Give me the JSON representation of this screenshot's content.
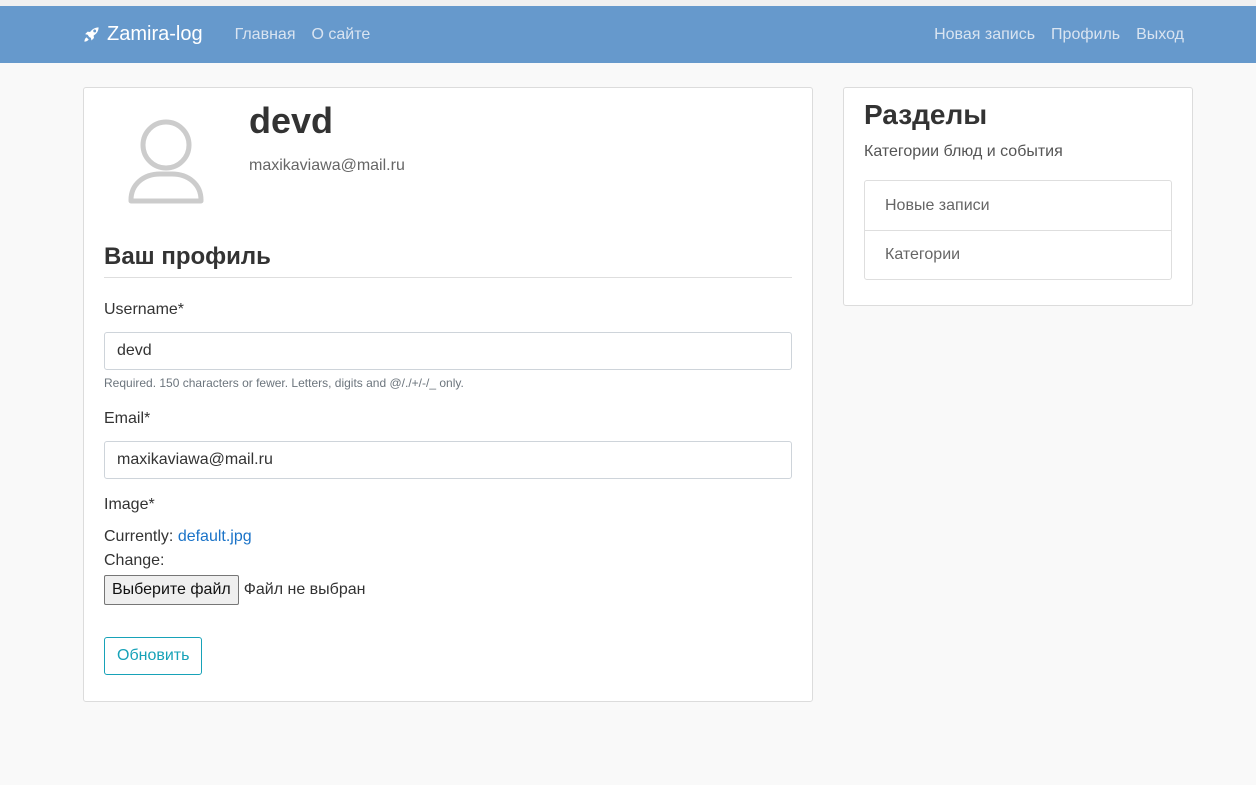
{
  "nav": {
    "brand": "Zamira-log",
    "brand_icon": "rocket-icon",
    "left_links": [
      "Главная",
      "О сайте"
    ],
    "right_links": [
      "Новая запись",
      "Профиль",
      "Выход"
    ],
    "bg_color": "#6699cc"
  },
  "profile": {
    "username": "devd",
    "email": "maxikaviawa@mail.ru",
    "avatar_icon": "user-icon"
  },
  "form": {
    "title": "Ваш профиль",
    "username_label": "Username*",
    "username_value": "devd",
    "username_help": "Required. 150 characters or fewer. Letters, digits and @/./+/-/_ only.",
    "email_label": "Email*",
    "email_value": "maxikaviawa@mail.ru",
    "image_label": "Image*",
    "currently_label": "Currently:",
    "current_file": "default.jpg",
    "change_label": "Change:",
    "file_button": "Выберите файл",
    "file_status": "Файл не выбран",
    "submit_label": "Обновить",
    "accent_color": "#17a2b8"
  },
  "sidebar": {
    "title": "Разделы",
    "subtitle": "Категории блюд и события",
    "items": [
      "Новые записи",
      "Категории"
    ]
  }
}
